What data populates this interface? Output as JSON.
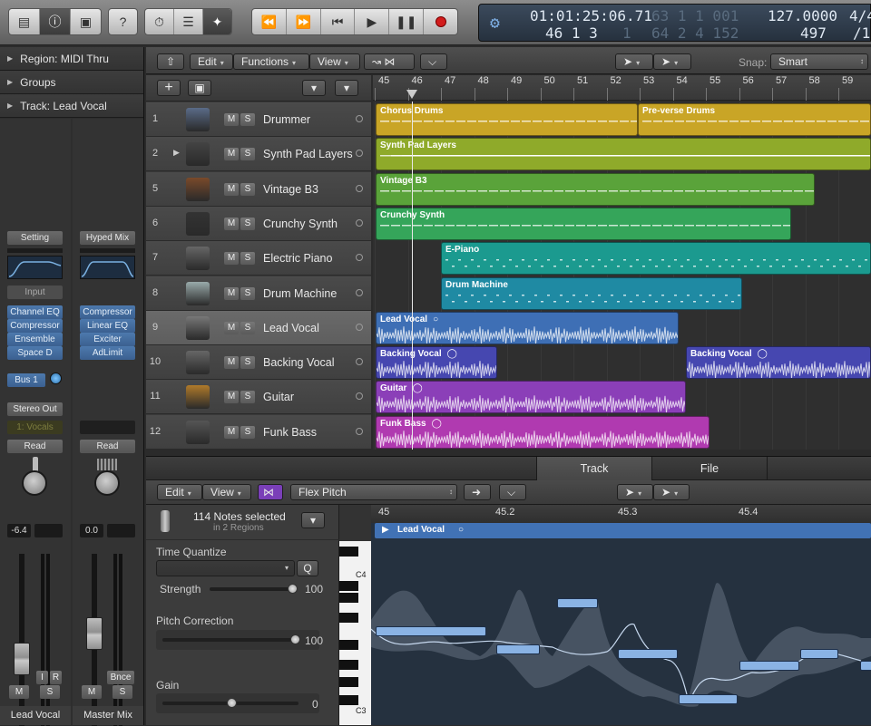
{
  "control_bar": {
    "lcd": {
      "time": "01:01:25:06.71",
      "time_dim": "63 1 1 001",
      "bars": "46 1 3",
      "bars_tick": "1",
      "bars_dim": "64 2 4 152",
      "tempo": "127.0000",
      "sig": "4/4",
      "tempo2": "497",
      "div": "/1"
    }
  },
  "inspector": {
    "region_label": "Region: MIDI Thru",
    "groups_label": "Groups",
    "track_label": "Track:  Lead Vocal",
    "strip1": {
      "setting": "Setting",
      "input": "Input",
      "plugins": [
        "Channel EQ",
        "Compressor",
        "Ensemble",
        "Space D"
      ],
      "send": "Bus 1",
      "output": "Stereo Out",
      "group": "1: Vocals",
      "automation": "Read",
      "volume": "-6.4",
      "ir": [
        "I",
        "R"
      ],
      "m": "M",
      "s": "S",
      "name": "Lead Vocal"
    },
    "strip2": {
      "setting": "Hyped Mix",
      "plugins": [
        "Compressor",
        "Linear EQ",
        "Exciter",
        "AdLimit"
      ],
      "automation": "Read",
      "volume": "0.0",
      "bnce": "Bnce",
      "m": "M",
      "s": "S",
      "name": "Master Mix"
    }
  },
  "tracks_header": {
    "edit": "Edit",
    "functions": "Functions",
    "view": "View",
    "snap_label": "Snap:",
    "snap_value": "Smart"
  },
  "ruler_bars": [
    "45",
    "46",
    "47",
    "48",
    "49",
    "50",
    "51",
    "52",
    "53",
    "54",
    "55",
    "56",
    "57",
    "58",
    "59"
  ],
  "tracks": [
    {
      "num": "1",
      "name": "Drummer"
    },
    {
      "num": "2",
      "name": "Synth Pad Layers"
    },
    {
      "num": "5",
      "name": "Vintage B3"
    },
    {
      "num": "6",
      "name": "Crunchy Synth"
    },
    {
      "num": "7",
      "name": "Electric Piano"
    },
    {
      "num": "8",
      "name": "Drum Machine"
    },
    {
      "num": "9",
      "name": "Lead Vocal"
    },
    {
      "num": "10",
      "name": "Backing Vocal"
    },
    {
      "num": "11",
      "name": "Guitar"
    },
    {
      "num": "12",
      "name": "Funk Bass"
    }
  ],
  "track_ms": {
    "m": "M",
    "s": "S"
  },
  "regions": [
    "Chorus Drums",
    "Pre-verse Drums",
    "Synth Pad Layers",
    "Vintage B3",
    "Crunchy Synth",
    "E-Piano",
    "Drum Machine",
    "Lead Vocal",
    "Backing Vocal",
    "Backing Vocal",
    "Guitar",
    "Funk Bass"
  ],
  "editor": {
    "tabs": {
      "track": "Track",
      "file": "File"
    },
    "edit": "Edit",
    "view": "View",
    "mode": "Flex Pitch",
    "notes_selected": "114 Notes selected",
    "in_regions": "in 2 Regions",
    "time_quantize": "Time Quantize",
    "quantize_q": "Q",
    "strength_label": "Strength",
    "strength_value": "100",
    "pitch_correction": "Pitch Correction",
    "pitch_value": "100",
    "gain_label": "Gain",
    "gain_value": "0",
    "c4": "C4",
    "c3": "C3",
    "ruler": [
      "45",
      "45.2",
      "45.3",
      "45.4"
    ],
    "region_name": "Lead Vocal"
  },
  "colors": {
    "drums": "#c9a526",
    "synthpad": "#8faa2a",
    "b3": "#5aa33a",
    "crunchy": "#35a55a",
    "epiano": "#1b9a8f",
    "drummachine": "#1f8aa3",
    "leadvocal": "#3e6fb5",
    "backing": "#4647b0",
    "guitar": "#8b3fb8",
    "bass": "#b03ab0"
  }
}
